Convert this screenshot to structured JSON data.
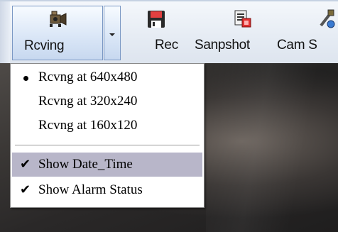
{
  "toolbar": {
    "buttons": [
      {
        "label": "Rcving",
        "icon": "camera-icon"
      },
      {
        "label": "Rec",
        "icon": "floppy-disk-icon"
      },
      {
        "label": "Sanpshot",
        "icon": "snapshot-icon"
      },
      {
        "label": "Cam S",
        "icon": "camera-settings-icon"
      }
    ],
    "dropdown_icon": "chevron-down-icon"
  },
  "menu": {
    "items": [
      {
        "label": "Rcvng at 640x480",
        "checked": true,
        "mark": "bullet"
      },
      {
        "label": "Rcvng at 320x240",
        "checked": false
      },
      {
        "label": "Rcvng at 160x120",
        "checked": false
      },
      {
        "label": "Show Date_Time",
        "checked": true,
        "mark": "✔"
      },
      {
        "label": "Show Alarm Status",
        "checked": true,
        "mark": "✔"
      }
    ],
    "highlight_color": "#b8b6c9"
  }
}
